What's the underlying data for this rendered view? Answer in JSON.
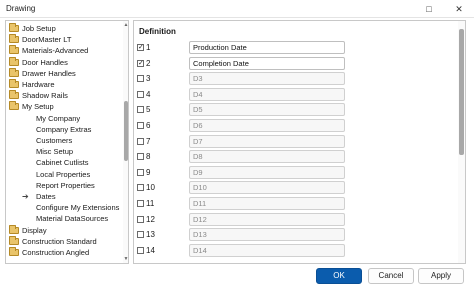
{
  "window": {
    "title": "Drawing",
    "maximize_glyph": "□",
    "close_glyph": "✕"
  },
  "tree": {
    "items": [
      {
        "label": "Job Setup",
        "type": "folder",
        "indent": 0
      },
      {
        "label": "DoorMaster LT",
        "type": "folder",
        "indent": 0
      },
      {
        "label": "Materials-Advanced",
        "type": "folder",
        "indent": 0
      },
      {
        "label": "Door Handles",
        "type": "folder",
        "indent": 0
      },
      {
        "label": "Drawer Handles",
        "type": "folder",
        "indent": 0
      },
      {
        "label": "Hardware",
        "type": "folder",
        "indent": 0
      },
      {
        "label": "Shadow Rails",
        "type": "folder",
        "indent": 0
      },
      {
        "label": "My Setup",
        "type": "folder",
        "indent": 0
      },
      {
        "label": "My Company",
        "type": "leaf",
        "indent": 1
      },
      {
        "label": "Company Extras",
        "type": "leaf",
        "indent": 1
      },
      {
        "label": "Customers",
        "type": "leaf",
        "indent": 1
      },
      {
        "label": "Misc Setup",
        "type": "leaf",
        "indent": 1
      },
      {
        "label": "Cabinet Cutlists",
        "type": "leaf",
        "indent": 1
      },
      {
        "label": "Local Properties",
        "type": "leaf",
        "indent": 1
      },
      {
        "label": "Report Properties",
        "type": "leaf",
        "indent": 1
      },
      {
        "label": "Dates",
        "type": "selected",
        "indent": 1
      },
      {
        "label": "Configure My Extensions",
        "type": "leaf",
        "indent": 1
      },
      {
        "label": "Material DataSources",
        "type": "leaf",
        "indent": 1
      },
      {
        "label": "Display",
        "type": "folder",
        "indent": 0
      },
      {
        "label": "Construction Standard",
        "type": "folder",
        "indent": 0
      },
      {
        "label": "Construction Angled",
        "type": "folder",
        "indent": 0
      }
    ],
    "selected_arrow": "➔"
  },
  "definition": {
    "heading": "Definition",
    "rows": [
      {
        "num": "1",
        "checked": true,
        "value": "Production Date"
      },
      {
        "num": "2",
        "checked": true,
        "value": "Completion Date"
      },
      {
        "num": "3",
        "checked": false,
        "value": "D3"
      },
      {
        "num": "4",
        "checked": false,
        "value": "D4"
      },
      {
        "num": "5",
        "checked": false,
        "value": "D5"
      },
      {
        "num": "6",
        "checked": false,
        "value": "D6"
      },
      {
        "num": "7",
        "checked": false,
        "value": "D7"
      },
      {
        "num": "8",
        "checked": false,
        "value": "D8"
      },
      {
        "num": "9",
        "checked": false,
        "value": "D9"
      },
      {
        "num": "10",
        "checked": false,
        "value": "D10"
      },
      {
        "num": "11",
        "checked": false,
        "value": "D11"
      },
      {
        "num": "12",
        "checked": false,
        "value": "D12"
      },
      {
        "num": "13",
        "checked": false,
        "value": "D13"
      },
      {
        "num": "14",
        "checked": false,
        "value": "D14"
      }
    ]
  },
  "buttons": {
    "ok": "OK",
    "cancel": "Cancel",
    "apply": "Apply"
  }
}
